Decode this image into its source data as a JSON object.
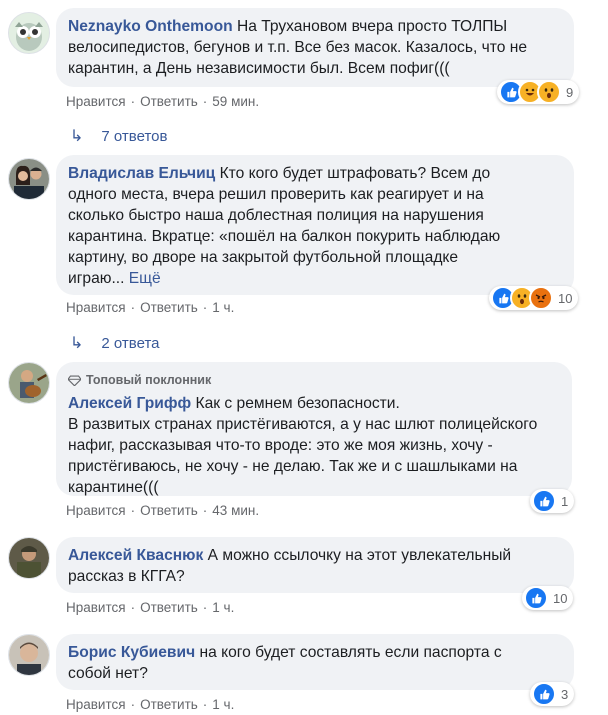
{
  "comments": [
    {
      "author": "Neznayko Onthemoon",
      "lines": [
        "На Трухановом вчера просто ТОЛПЫ",
        "велосипедистов, бегунов и т.п. Все без масок. Казалось, что не",
        "карантин, а День независимости был. Всем пофиг((("
      ],
      "like_label": "Нравится",
      "reply_label": "Ответить",
      "time": "59 мин.",
      "reaction_count": "9",
      "reaction_icons": [
        "like-icon",
        "haha-icon",
        "wow-icon"
      ],
      "replies_label": "7 ответов"
    },
    {
      "author": "Владислав Ельчиц",
      "lines": [
        "Кто кого будет штрафовать? Всем до",
        "одного места, вчера решил проверить как реагирует и на",
        "сколько быстро наша доблестная полиция на нарушения",
        "карантина. Вкратце: «пошёл на балкон покурить наблюдаю",
        "картину, во дворе на закрытой футбольной площадке",
        "играю..."
      ],
      "more_label": "Ещё",
      "like_label": "Нравится",
      "reply_label": "Ответить",
      "time": "1 ч.",
      "reaction_count": "10",
      "reaction_icons": [
        "like-icon",
        "wow-icon",
        "angry-icon"
      ],
      "replies_label": "2 ответа"
    },
    {
      "badge": "Топовый поклонник",
      "author": "Алексей Грифф",
      "lines": [
        "Как с ремнем безопасности.",
        "В развитых странах пристёгиваются, а у нас шлют полицейского",
        "нафиг, рассказывая что-то вроде: это же моя жизнь, хочу -",
        "пристёгиваюсь, не хочу - не делаю. Так же и с шашлыками на",
        "карантине((("
      ],
      "like_label": "Нравится",
      "reply_label": "Ответить",
      "time": "43 мин.",
      "reaction_count": "1",
      "reaction_icons": [
        "like-icon"
      ]
    },
    {
      "author": "Алексей Кваснюк",
      "lines": [
        "А можно ссылочку на этот увлекательный",
        "рассказ в КГГА?"
      ],
      "like_label": "Нравится",
      "reply_label": "Ответить",
      "time": "1 ч.",
      "reaction_count": "10",
      "reaction_icons": [
        "like-icon"
      ]
    },
    {
      "author": "Борис Кубиевич",
      "lines": [
        "на кого будет составлять если паспорта с",
        "собой нет?"
      ],
      "like_label": "Нравится",
      "reply_label": "Ответить",
      "time": "1 ч.",
      "reaction_count": "3",
      "reaction_icons": [
        "like-icon"
      ]
    }
  ],
  "colors": {
    "link": "#385898",
    "bubble": "#f0f2f5",
    "meta": "#65676b",
    "like": "#1877f2"
  }
}
